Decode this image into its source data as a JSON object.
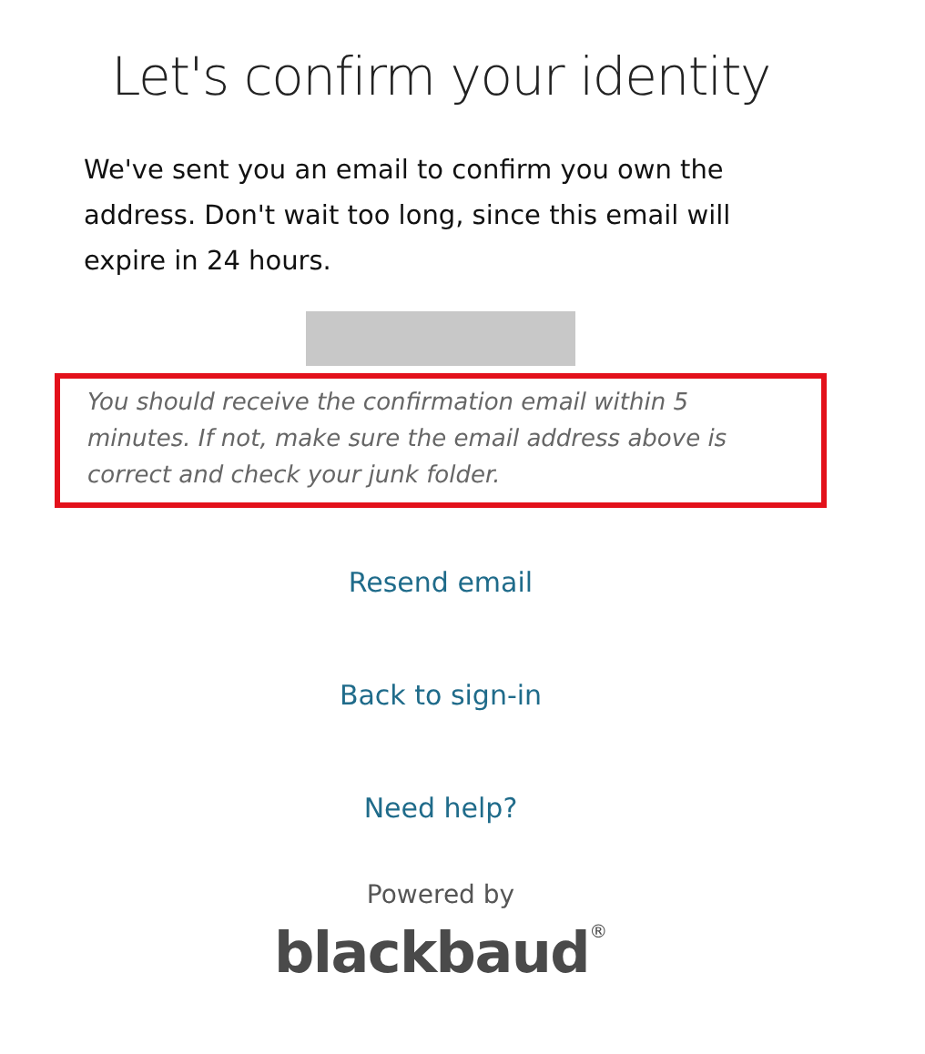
{
  "title": "Let's confirm your identity",
  "message": "We've sent you an email to confirm you own the address. Don't wait too long, since this email will expire in 24 hours.",
  "note": {
    "text": "You should receive the confirmation email within 5 minutes. If not, make sure the email address above is correct and check your junk folder.",
    "highlighted": true
  },
  "links": [
    {
      "label": "Resend email"
    },
    {
      "label": "Back to sign-in"
    },
    {
      "label": "Need help?"
    }
  ],
  "footer": {
    "powered_by": "Powered by",
    "logo": "blackbaud",
    "logo_mark": "®"
  }
}
